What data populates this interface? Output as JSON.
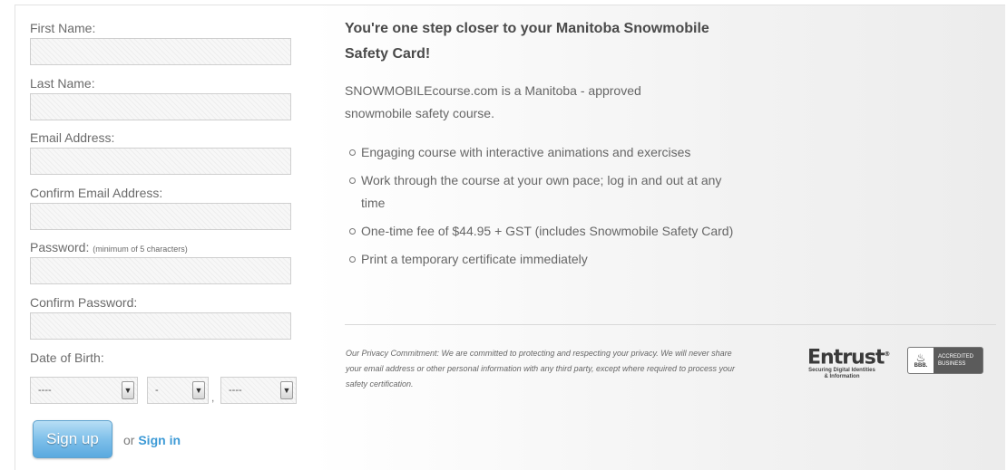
{
  "form": {
    "first_name_label": "First Name:",
    "last_name_label": "Last Name:",
    "email_label": "Email Address:",
    "confirm_email_label": "Confirm Email Address:",
    "password_label": "Password:",
    "password_hint": "(minimum of 5 characters)",
    "confirm_password_label": "Confirm Password:",
    "dob_label": "Date of Birth:",
    "dob_month_value": "----",
    "dob_day_value": "-",
    "dob_separator": ",",
    "dob_year_value": "----",
    "signup_label": "Sign up",
    "or_text": "or",
    "signin_label": "Sign in"
  },
  "info": {
    "heading": "You're one step closer to your Manitoba Snowmobile Safety Card!",
    "intro": "SNOWMOBILEcourse.com is a Manitoba - approved snowmobile safety course.",
    "bullets": [
      "Engaging course with interactive animations and exercises",
      "Work through the course at your own pace; log in and out at any time",
      "One-time fee of $44.95 + GST (includes Snowmobile Safety Card)",
      "Print a temporary certificate immediately"
    ],
    "privacy": "Our Privacy Commitment: We are committed to protecting and respecting your privacy. We will never share your email address or other personal information with any third party, except where required to process your safety certification."
  },
  "badges": {
    "entrust_brand": "Entrust",
    "entrust_tagline": "Securing Digital Identities & Information",
    "bbb_text": "BBB.",
    "bbb_accredited": "ACCREDITED BUSINESS"
  },
  "colors": {
    "accent": "#3d9ad6",
    "button_top": "#b7def5",
    "button_bottom": "#5aa9df"
  }
}
